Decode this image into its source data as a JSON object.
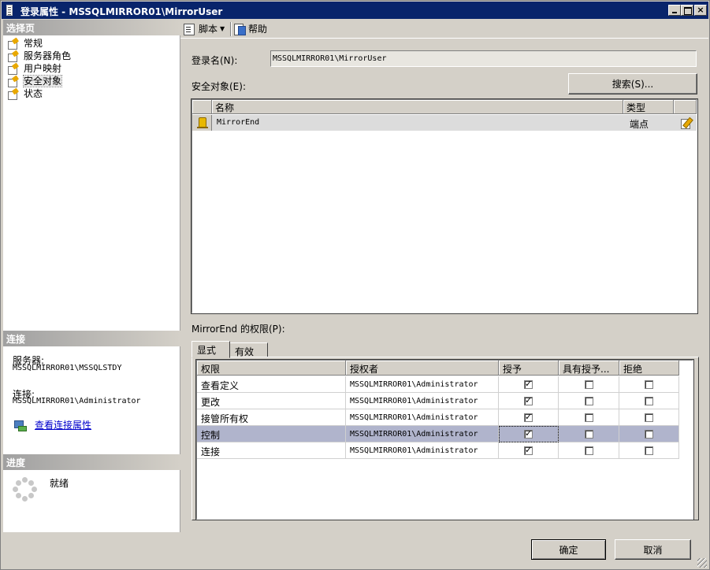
{
  "window": {
    "title": "登录属性 - MSSQLMIRROR01\\MirrorUser",
    "controls": {
      "minimize": "minimize",
      "maximize": "maximize",
      "close": "×"
    }
  },
  "left_pane": {
    "pages_header": "选择页",
    "pages": [
      {
        "label": "常规",
        "selected": false
      },
      {
        "label": "服务器角色",
        "selected": false
      },
      {
        "label": "用户映射",
        "selected": false
      },
      {
        "label": "安全对象",
        "selected": true
      },
      {
        "label": "状态",
        "selected": false
      }
    ],
    "connection_header": "连接",
    "server_label": "服务器:",
    "server_value": "MSSQLMIRROR01\\MSSQLSTDY",
    "connection_label": "连接:",
    "connection_value": "MSSQLMIRROR01\\Administrator",
    "view_connection_link": "查看连接属性",
    "progress_header": "进度",
    "progress_status": "就绪"
  },
  "toolbar": {
    "script_label": "脚本",
    "script_dropdown": "▼",
    "help_label": "帮助"
  },
  "main": {
    "login_label": "登录名(N):",
    "login_value": "MSSQLMIRROR01\\MirrorUser",
    "securables_label": "安全对象(E):",
    "search_button": "搜索(S)...",
    "securables_grid": {
      "columns": [
        "名称",
        "类型"
      ],
      "rows": [
        {
          "name": "MirrorEnd",
          "type": "端点"
        }
      ]
    },
    "permissions_title": "MirrorEnd 的权限(P):",
    "tabs": [
      {
        "label": "显式",
        "active": true
      },
      {
        "label": "有效",
        "active": false
      }
    ],
    "permissions_grid": {
      "columns": [
        "权限",
        "授权者",
        "授予",
        "具有授予...",
        "拒绝"
      ],
      "rows": [
        {
          "permission": "查看定义",
          "grantor": "MSSQLMIRROR01\\Administrator",
          "grant": true,
          "with_grant": false,
          "deny": false,
          "selected": false
        },
        {
          "permission": "更改",
          "grantor": "MSSQLMIRROR01\\Administrator",
          "grant": true,
          "with_grant": false,
          "deny": false,
          "selected": false
        },
        {
          "permission": "接管所有权",
          "grantor": "MSSQLMIRROR01\\Administrator",
          "grant": true,
          "with_grant": false,
          "deny": false,
          "selected": false
        },
        {
          "permission": "控制",
          "grantor": "MSSQLMIRROR01\\Administrator",
          "grant": true,
          "with_grant": false,
          "deny": false,
          "selected": true
        },
        {
          "permission": "连接",
          "grantor": "MSSQLMIRROR01\\Administrator",
          "grant": true,
          "with_grant": false,
          "deny": false,
          "selected": false
        }
      ]
    }
  },
  "footer": {
    "ok_button": "确定",
    "cancel_button": "取消"
  },
  "colors": {
    "title_bar": "#08246b",
    "selected_row": "#b0b4cc",
    "link": "#0000cc"
  }
}
